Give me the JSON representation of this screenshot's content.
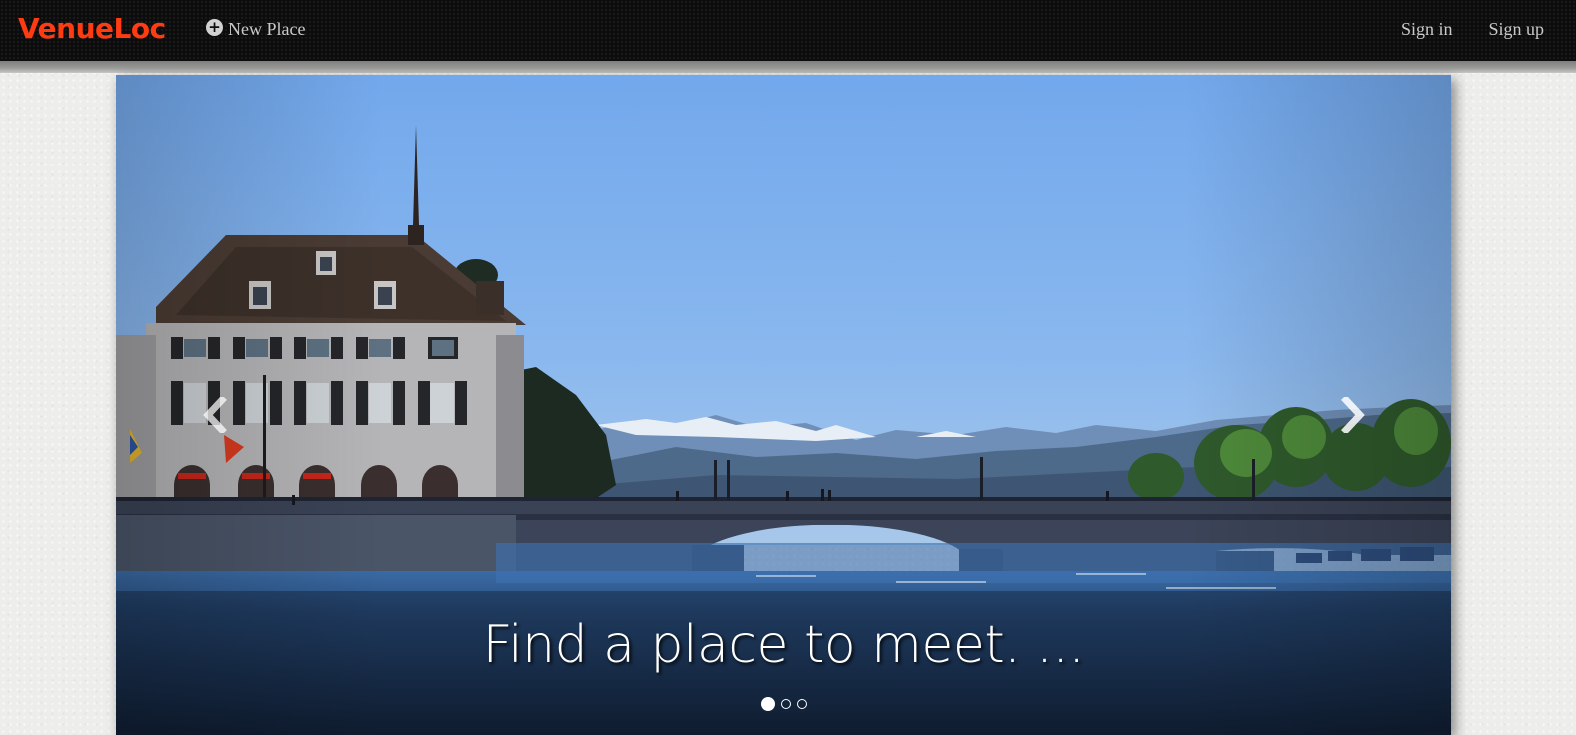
{
  "navbar": {
    "brand": "VenueLoc",
    "new_place_label": "New Place",
    "new_place_icon": "plus-circle-icon",
    "sign_in_label": "Sign in",
    "sign_up_label": "Sign up",
    "brand_color": "#ff3b12"
  },
  "carousel": {
    "active_slide": 1,
    "slide_count": 3,
    "caption": "Find a place to meet. ...",
    "prev_icon": "chevron-left-icon",
    "next_icon": "chevron-right-icon"
  }
}
